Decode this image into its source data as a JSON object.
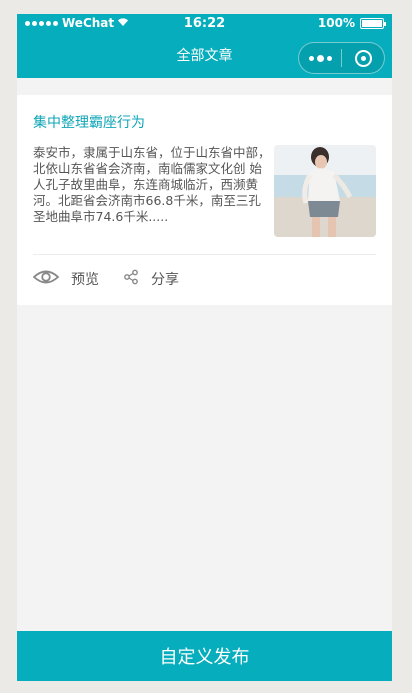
{
  "status_bar": {
    "carrier": "WeChat",
    "time": "16:22",
    "battery": "100%"
  },
  "nav": {
    "title": "全部文章"
  },
  "article": {
    "title": "集中整理霸座行为",
    "description": "泰安市，隶属于山东省，位于山东省中部，北依山东省省会济南，南临儒家文化创 始人孔子故里曲阜，东连商城临沂，西濒黄河。北距省会济南市66.8千米，南至三孔圣地曲阜市74.6千米.....",
    "actions": {
      "preview": "预览",
      "share": "分享"
    }
  },
  "bottom": {
    "publish_label": "自定义发布"
  },
  "colors": {
    "accent": "#06aebd",
    "title_color": "#11a6b8"
  }
}
